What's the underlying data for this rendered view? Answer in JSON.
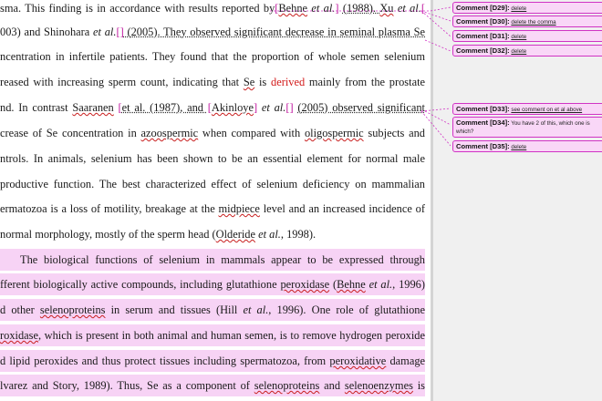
{
  "document": {
    "lines": [
      {
        "segments": [
          {
            "t": "sma. This finding is in accordance with results reported by"
          },
          {
            "t": "[",
            "cls": "bracket"
          },
          {
            "t": "Behne",
            "cls": "sq"
          },
          {
            "t": " "
          },
          {
            "t": "et al.",
            "cls": "it"
          },
          {
            "t": "] ",
            "cls": "bracket"
          },
          {
            "t": "(1988). ",
            "cls": "dot"
          },
          {
            "t": "Xu",
            "cls": "sq"
          },
          {
            "t": " "
          },
          {
            "t": "et al.",
            "cls": "it"
          },
          {
            "t": "[",
            "cls": "bracket"
          }
        ]
      },
      {
        "segments": [
          {
            "t": "003) and Shinohara "
          },
          {
            "t": "et al.",
            "cls": "it"
          },
          {
            "t": "[]",
            "cls": "bracket"
          },
          {
            "t": " (2005). They observed significant decrease in seminal plasma Se",
            "cls": "dot"
          }
        ]
      },
      {
        "segments": [
          {
            "t": "ncentration in infertile patients. They found that the proportion of whole semen selenium"
          }
        ]
      },
      {
        "segments": [
          {
            "t": "reased with increasing sperm count, indicating that "
          },
          {
            "t": "Se",
            "cls": "sq"
          },
          {
            "t": " is "
          },
          {
            "t": "derived",
            "cls": "ins"
          },
          {
            "t": " mainly from the prostate"
          }
        ]
      },
      {
        "segments": [
          {
            "t": "nd. In contrast "
          },
          {
            "t": "Saaranen",
            "cls": "sq"
          },
          {
            "t": " [",
            "cls": "bracket"
          },
          {
            "t": "et al. (1987), and ",
            "cls": "dot"
          },
          {
            "t": "[",
            "cls": "bracket"
          },
          {
            "t": "Akinloye",
            "cls": "sq"
          },
          {
            "t": "] ",
            "cls": "bracket"
          },
          {
            "t": "et al.",
            "cls": "it"
          },
          {
            "t": "[] ",
            "cls": "bracket"
          },
          {
            "t": "(2005) observed significant",
            "cls": "dot"
          }
        ]
      },
      {
        "segments": [
          {
            "t": "crease of Se concentration in "
          },
          {
            "t": "azoospermic",
            "cls": "sq"
          },
          {
            "t": " when compared with "
          },
          {
            "t": "oligospermic",
            "cls": "sq"
          },
          {
            "t": " subjects and"
          }
        ]
      },
      {
        "segments": [
          {
            "t": "ntrols. In animals, selenium has been shown to be an essential element for normal male"
          }
        ]
      },
      {
        "segments": [
          {
            "t": "productive function. The best characterized effect of selenium deficiency on mammalian"
          }
        ]
      },
      {
        "segments": [
          {
            "t": "ermatozoa is a loss of motility, breakage at the "
          },
          {
            "t": "midpiece",
            "cls": "sq"
          },
          {
            "t": " level and an increased incidence of"
          }
        ]
      },
      {
        "noj": true,
        "segments": [
          {
            "t": "normal morphology, mostly of the sperm head ("
          },
          {
            "t": "Olderide",
            "cls": "sq"
          },
          {
            "t": " "
          },
          {
            "t": "et al.",
            "cls": "it"
          },
          {
            "t": ", 1998)."
          }
        ]
      },
      {
        "hl": true,
        "indent": true,
        "segments": [
          {
            "t": "The biological functions of selenium in mammals appear to be expressed through"
          }
        ]
      },
      {
        "hl": true,
        "segments": [
          {
            "t": "fferent biologically active compounds, including glutathione "
          },
          {
            "t": "peroxidase",
            "cls": "sq"
          },
          {
            "t": " ("
          },
          {
            "t": "Behne",
            "cls": "sq"
          },
          {
            "t": " "
          },
          {
            "t": "et al.",
            "cls": "it"
          },
          {
            "t": ", 1996)"
          }
        ]
      },
      {
        "hl": true,
        "segments": [
          {
            "t": "d other "
          },
          {
            "t": "selenoproteins",
            "cls": "sq"
          },
          {
            "t": " in serum and tissues (Hill "
          },
          {
            "t": "et al.",
            "cls": "it"
          },
          {
            "t": ", 1996). One role of glutathione"
          }
        ]
      },
      {
        "hl": true,
        "segments": [
          {
            "t": "roxidase",
            "cls": "sq"
          },
          {
            "t": ", which is present in both animal and human semen, is to remove hydrogen peroxide"
          }
        ]
      },
      {
        "hl": true,
        "segments": [
          {
            "t": "d lipid peroxides and thus protect tissues including spermatozoa, from "
          },
          {
            "t": "peroxidative",
            "cls": "sq"
          },
          {
            "t": " damage"
          }
        ]
      },
      {
        "hl": true,
        "segments": [
          {
            "t": "lvarez and Story, 1989). Thus, Se as a component of "
          },
          {
            "t": "selenoproteins",
            "cls": "sq"
          },
          {
            "t": " and "
          },
          {
            "t": "selenoenzymes",
            "cls": "sq"
          },
          {
            "t": " is"
          }
        ]
      }
    ]
  },
  "comments": [
    {
      "label": "Comment [D29]:",
      "text": "delete"
    },
    {
      "label": "Comment [D30]:",
      "text": "delete the comma"
    },
    {
      "label": "Comment [D31]:",
      "text": "delete"
    },
    {
      "label": "Comment [D32]:",
      "text": "delete"
    },
    {
      "label": "Comment [D33]:",
      "text": "see comment on et al above"
    },
    {
      "label": "Comment [D34]:",
      "text": "You have 2 of this, which one is which?"
    },
    {
      "label": "Comment [D35]:",
      "text": "delete"
    }
  ],
  "colors": {
    "comment_border": "#d033c4",
    "comment_fill": "#f9d7f7",
    "highlight": "#f7d3f5",
    "spelling_squiggle": "#c81e1e"
  }
}
